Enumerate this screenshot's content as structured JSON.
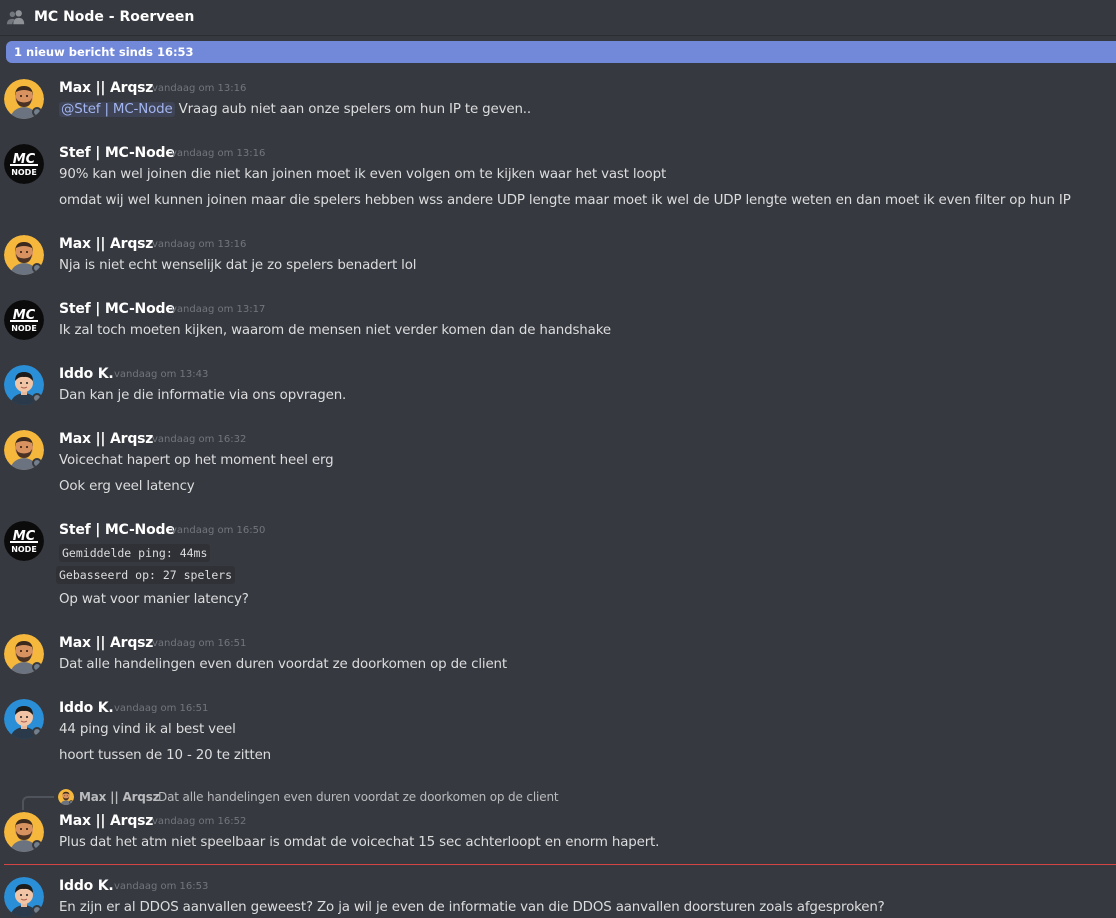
{
  "header": {
    "title": "MC Node - Roerveen",
    "icon": "members-icon"
  },
  "banner": {
    "text": "1 nieuw bericht sinds 16:53",
    "color": "#7289da"
  },
  "colors": {
    "background": "#36393f",
    "username": "#ffffff",
    "timestamp": "#72767d",
    "mention": "#a3b5f0",
    "new_divider": "#f04747"
  },
  "messages": [
    {
      "author": "Max || Arqsz",
      "time": "vandaag om 13:16",
      "mention": "@Stef | MC-Node",
      "lines": [
        "Vraag aub niet aan onze spelers om hun IP te geven.."
      ]
    },
    {
      "author": "Stef | MC-Node",
      "time": "vandaag om 13:16",
      "lines": [
        "90% kan wel joinen die niet kan joinen moet ik even volgen om te kijken waar het vast loopt",
        "omdat wij wel kunnen joinen maar die spelers hebben wss andere UDP lengte maar moet ik wel de UDP lengte weten en dan moet ik even filter op hun IP"
      ]
    },
    {
      "author": "Max || Arqsz",
      "time": "vandaag om 13:16",
      "lines": [
        "Nja is niet echt wenselijk dat je zo spelers benadert lol"
      ]
    },
    {
      "author": "Stef | MC-Node",
      "time": "vandaag om 13:17",
      "lines": [
        "Ik zal toch moeten kijken, waarom de mensen niet verder komen dan de handshake"
      ]
    },
    {
      "author": "Iddo K.",
      "time": "vandaag om 13:43",
      "lines": [
        "Dan kan je die informatie via ons opvragen."
      ]
    },
    {
      "author": "Max || Arqsz",
      "time": "vandaag om 16:32",
      "lines": [
        "Voicechat hapert op het moment heel erg",
        "Ook erg veel latency"
      ]
    },
    {
      "author": "Stef | MC-Node",
      "time": "vandaag om 16:50",
      "code": [
        "Gemiddelde ping: 44ms",
        "Gebasseerd op: 27 spelers"
      ],
      "lines": [
        "Op wat voor manier latency?"
      ]
    },
    {
      "author": "Max || Arqsz",
      "time": "vandaag om 16:51",
      "lines": [
        "Dat alle handelingen even duren voordat ze doorkomen op de client"
      ]
    },
    {
      "author": "Iddo K.",
      "time": "vandaag om 16:51",
      "lines": [
        "44 ping vind ik al best veel",
        "hoort tussen de 10 - 20 te zitten"
      ]
    },
    {
      "author": "Max || Arqsz",
      "time": "vandaag om 16:52",
      "reply_to": {
        "author": "Max || Arqsz",
        "text": "Dat alle handelingen even duren voordat ze doorkomen op de client"
      },
      "lines": [
        "Plus dat het atm niet speelbaar is omdat de voicechat 15 sec achterloopt en enorm hapert."
      ]
    },
    {
      "author": "Iddo K.",
      "time": "vandaag om 16:53",
      "lines": [
        "En zijn er al DDOS aanvallen geweest? Zo ja wil je even de informatie van die DDOS aanvallen doorsturen zoals afgesproken?"
      ]
    }
  ]
}
